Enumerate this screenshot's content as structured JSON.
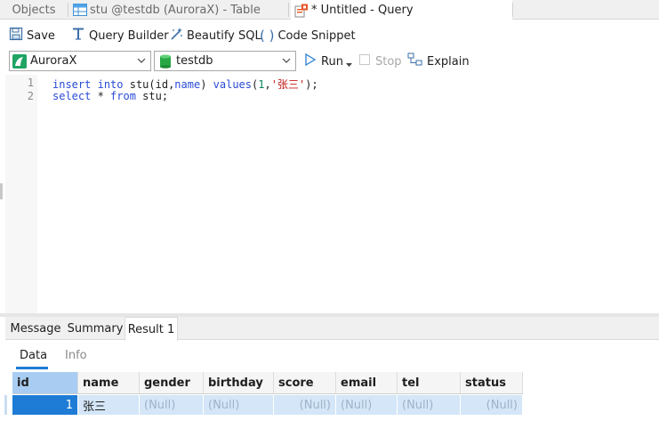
{
  "tabs": [
    {
      "label": "Objects"
    },
    {
      "label": "stu @testdb (AuroraX) - Table"
    },
    {
      "label": "* Untitled - Query"
    }
  ],
  "toolbar": {
    "save": "Save",
    "query_builder": "Query Builder",
    "beautify": "Beautify SQL",
    "code_snippet": "Code Snippet",
    "run": "Run",
    "stop": "Stop",
    "explain": "Explain"
  },
  "connection": {
    "selected": "AuroraX"
  },
  "database": {
    "selected": "testdb"
  },
  "editor": {
    "lines": [
      {
        "num": "1",
        "tokens": [
          {
            "t": "insert",
            "c": "kw"
          },
          {
            "t": " ",
            "c": ""
          },
          {
            "t": "into",
            "c": "kw"
          },
          {
            "t": " stu(id,",
            "c": ""
          },
          {
            "t": "name",
            "c": "kw"
          },
          {
            "t": ") ",
            "c": ""
          },
          {
            "t": "values",
            "c": "kw"
          },
          {
            "t": "(",
            "c": ""
          },
          {
            "t": "1",
            "c": "num"
          },
          {
            "t": ",",
            "c": ""
          },
          {
            "t": "'张三'",
            "c": "str"
          },
          {
            "t": ");",
            "c": ""
          }
        ]
      },
      {
        "num": "2",
        "tokens": [
          {
            "t": "select",
            "c": "kw"
          },
          {
            "t": " * ",
            "c": ""
          },
          {
            "t": "from",
            "c": "kw"
          },
          {
            "t": " stu;",
            "c": ""
          }
        ]
      }
    ]
  },
  "result_tabs": [
    {
      "label": "Message"
    },
    {
      "label": "Summary"
    },
    {
      "label": "Result 1"
    }
  ],
  "sub_tabs": [
    {
      "label": "Data"
    },
    {
      "label": "Info"
    }
  ],
  "grid": {
    "columns": [
      "id",
      "name",
      "gender",
      "birthday",
      "score",
      "email",
      "tel",
      "status"
    ],
    "rows": [
      [
        "1",
        "张三",
        "(Null)",
        "(Null)",
        "(Null)",
        "(Null)",
        "(Null)",
        "(Null)"
      ]
    ]
  },
  "colors": {
    "accent": "#1e7cd6",
    "keyword": "#2a4bd7",
    "string": "#c41a16",
    "number": "#098658",
    "selected_row": "#d4e6f8"
  }
}
